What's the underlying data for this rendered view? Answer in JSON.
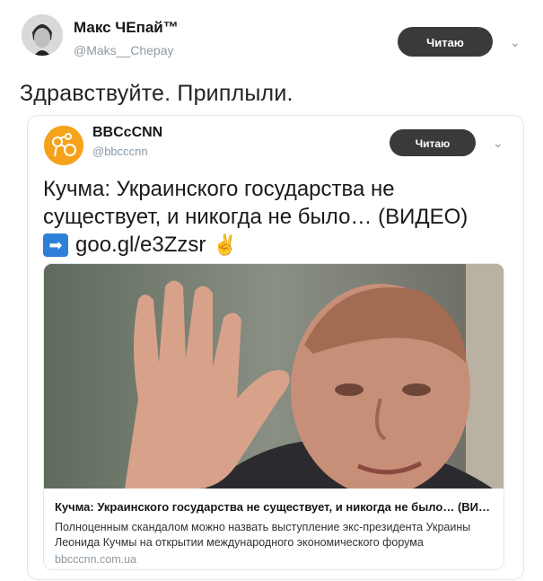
{
  "outer_tweet": {
    "author_name": "Макс ЧЕпай™",
    "author_handle": "@Maks__Chepay",
    "follow_label": "Читаю",
    "text": "Здравствуйте. Приплыли."
  },
  "quoted_tweet": {
    "author_name": "BBCcCNN",
    "author_handle": "@bbcccnn",
    "follow_label": "Читаю",
    "text_line": "Кучма: Украинского государства не существует, и никогда не было… (ВИДЕО)",
    "link_text": "goo.gl/e3Zzsr",
    "link_card": {
      "title": "Кучма: Украинского государства не существует, и никогда не было… (ВИД…",
      "description": "Полноценным скандалом можно назвать выступление экс-президента Украины Леонида Кучмы на открытии международного экономического форума",
      "domain": "bbcccnn.com.ua"
    }
  },
  "icons": {
    "chevron": "chevron-down-icon",
    "arrow": "arrow-right-icon",
    "victory": "victory-hand-icon"
  },
  "colors": {
    "follow_button": "#3a3a3a",
    "handle_gray": "#8d9aa5",
    "avatar_orange": "#f6a21b",
    "arrow_blue": "#2e7fd8"
  }
}
